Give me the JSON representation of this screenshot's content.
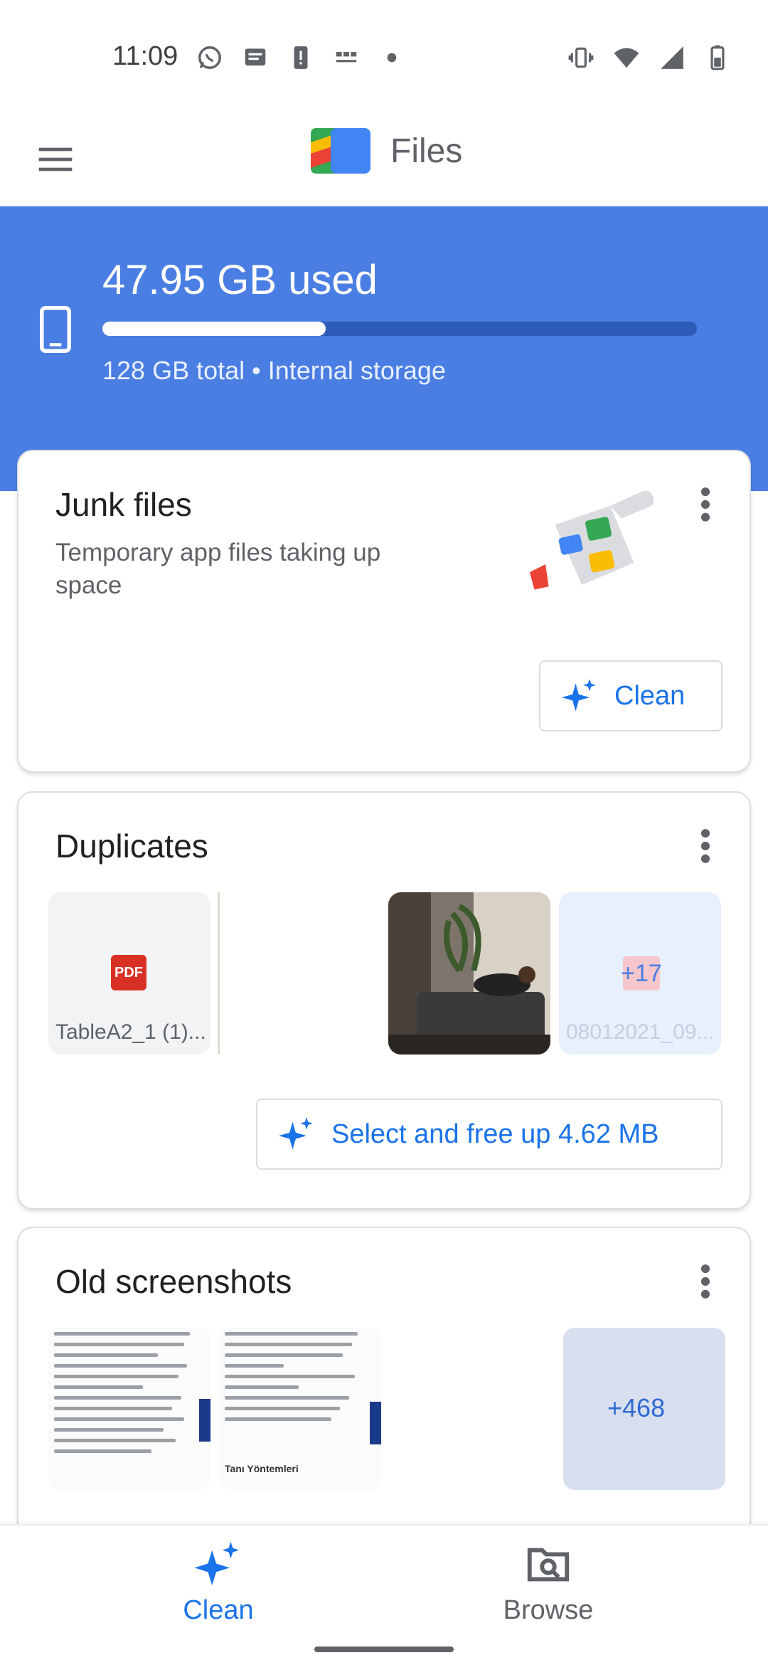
{
  "status_bar": {
    "time": "11:09",
    "left_icons": [
      "whatsapp-icon",
      "message-icon",
      "alert-icon",
      "news-icon",
      "dot-icon"
    ],
    "right_icons": [
      "vibrate-icon",
      "wifi-icon",
      "signal-icon",
      "battery-icon"
    ]
  },
  "app_bar": {
    "title": "Files"
  },
  "storage": {
    "used": "47.95 GB used",
    "fill_fraction": 0.375,
    "total": "128 GB total • Internal storage"
  },
  "junk": {
    "title": "Junk files",
    "subtitle": "Temporary app files taking up space",
    "button": "Clean"
  },
  "duplicates": {
    "title": "Duplicates",
    "file_caption": "TableA2_1 (1)...",
    "pdf_label": "PDF",
    "more_count": "+17",
    "more_caption": "08012021_09...",
    "button": "Select and free up 4.62 MB"
  },
  "screenshots": {
    "title": "Old screenshots",
    "heading_text": "Tanı Yöntemleri",
    "more_count": "+468"
  },
  "bottom_nav": {
    "clean": "Clean",
    "browse": "Browse"
  },
  "colors": {
    "accent": "#1a73e8",
    "banner": "#4a7ee3"
  }
}
